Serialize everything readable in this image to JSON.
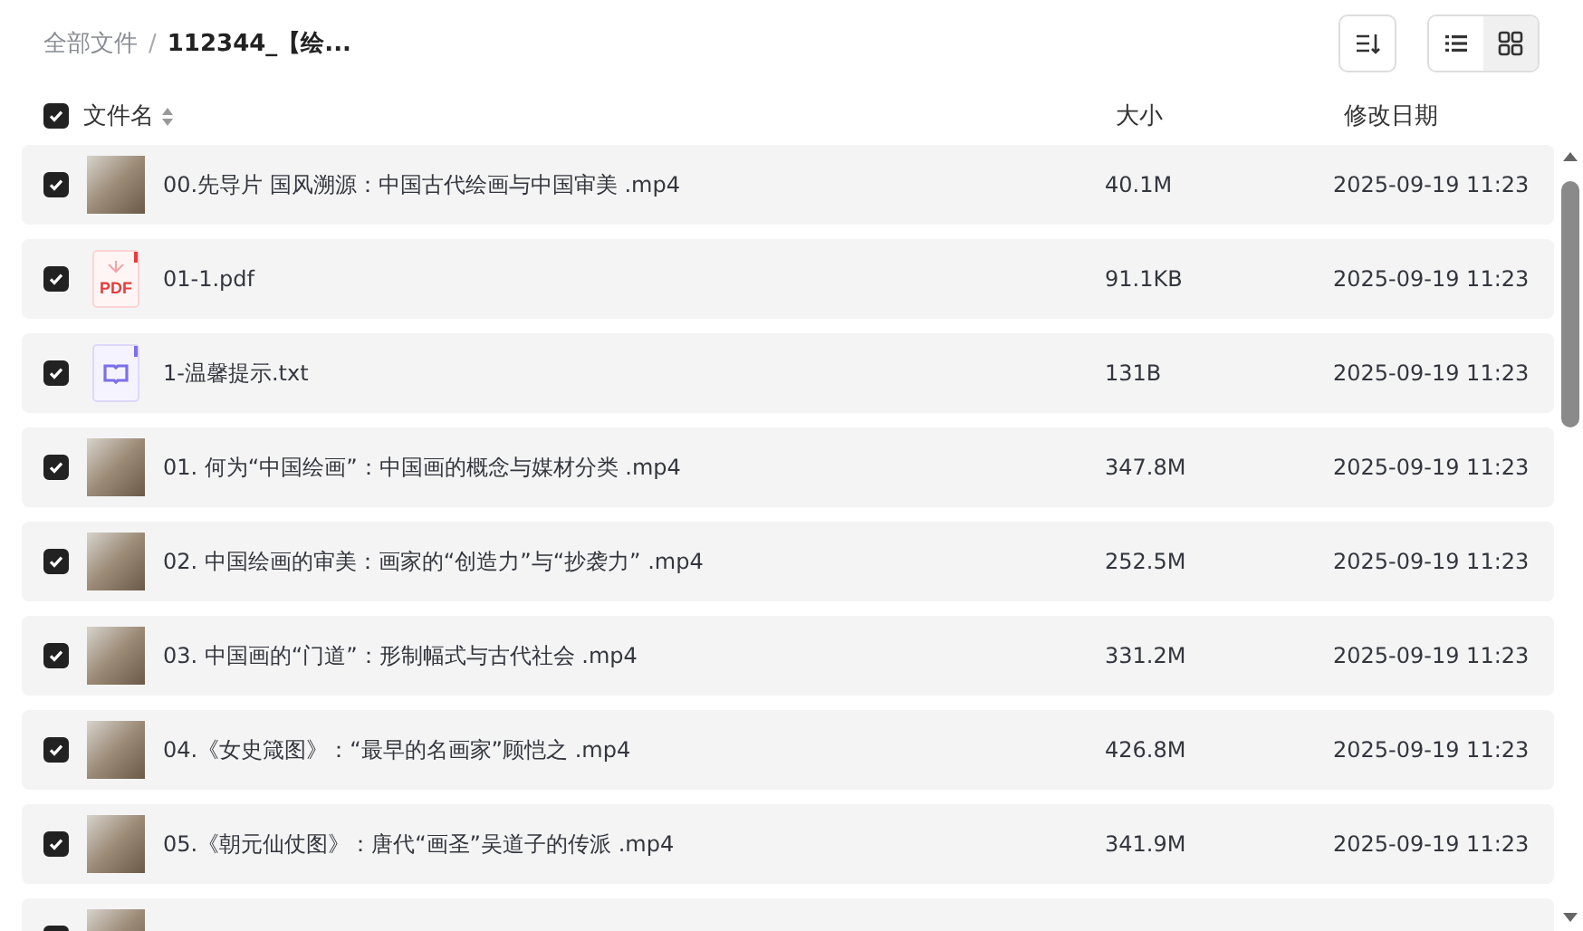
{
  "breadcrumb": [
    {
      "label": "全部文件",
      "current": false
    },
    {
      "label": "112344_【绘...",
      "current": true
    }
  ],
  "breadcrumb_separator": "/",
  "toolbar": {
    "view_toggle": [
      {
        "kind": "list",
        "selected": true
      },
      {
        "kind": "grid",
        "selected": false
      }
    ]
  },
  "table": {
    "select_all": {
      "checked": true
    },
    "columns": [
      {
        "label": "文件名",
        "sortable": true
      },
      {
        "label": "大小",
        "sortable": false
      },
      {
        "label": "修改日期",
        "sortable": false
      }
    ],
    "rows": [
      {
        "kind": "video",
        "checked": true,
        "name": "00.先导片 国风溯源：中国古代绘画与中国审美 .mp4",
        "size": "40.1M",
        "modified": "2025-09-19 11:23"
      },
      {
        "kind": "pdf",
        "checked": true,
        "icon_label": "PDF",
        "name": "01-1.pdf",
        "size": "91.1KB",
        "modified": "2025-09-19 11:23"
      },
      {
        "kind": "txt",
        "checked": true,
        "name": "1-温馨提示.txt",
        "size": "131B",
        "modified": "2025-09-19 11:23"
      },
      {
        "kind": "video",
        "checked": true,
        "name": "01. 何为“中国绘画”：中国画的概念与媒材分类 .mp4",
        "size": "347.8M",
        "modified": "2025-09-19 11:23"
      },
      {
        "kind": "video",
        "checked": true,
        "name": "02. 中国绘画的审美：画家的“创造力”与“抄袭力” .mp4",
        "size": "252.5M",
        "modified": "2025-09-19 11:23"
      },
      {
        "kind": "video",
        "checked": true,
        "name": "03. 中国画的“门道”：形制幅式与古代社会 .mp4",
        "size": "331.2M",
        "modified": "2025-09-19 11:23"
      },
      {
        "kind": "video",
        "checked": true,
        "name": "04.《女史箴图》：“最早的名画家”顾恺之 .mp4",
        "size": "426.8M",
        "modified": "2025-09-19 11:23"
      },
      {
        "kind": "video",
        "checked": true,
        "name": "05.《朝元仙仗图》：唐代“画圣”吴道子的传派 .mp4",
        "size": "341.9M",
        "modified": "2025-09-19 11:23"
      },
      {
        "kind": "video",
        "checked": true
      }
    ]
  }
}
